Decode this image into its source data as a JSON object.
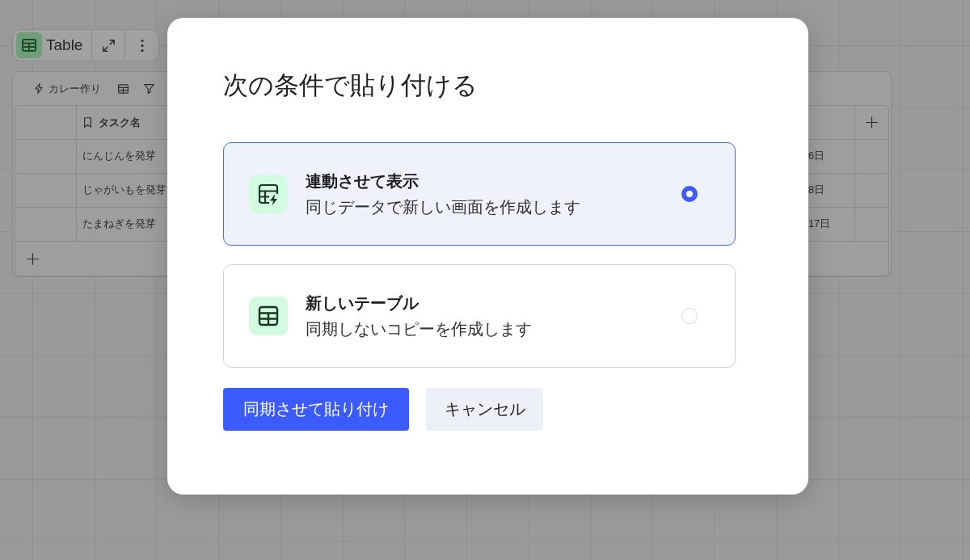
{
  "view_toolbar": {
    "label": "Table"
  },
  "table_panel": {
    "automation": "カレー作り",
    "task_column": {
      "label": "タスク名"
    },
    "rows": [
      {
        "task": "にんじんを発芽",
        "column_3": "6日"
      },
      {
        "task": "じゃがいもを発芽",
        "column_3": "8日"
      },
      {
        "task": "たまねぎを発芽",
        "column_3": "17日"
      }
    ]
  },
  "dialog": {
    "title": "次の条件で貼り付ける",
    "options": [
      {
        "kind": "linked",
        "title": "連動させて表示",
        "description": "同じデータで新しい画面を作成します",
        "selected": true
      },
      {
        "kind": "table",
        "title": "新しいテーブル",
        "description": "同期しないコピーを作成します",
        "selected": false
      }
    ],
    "buttons": [
      {
        "kind": "primary",
        "label": "同期させて貼り付け"
      },
      {
        "kind": "secondary",
        "label": "キャンセル"
      }
    ]
  }
}
